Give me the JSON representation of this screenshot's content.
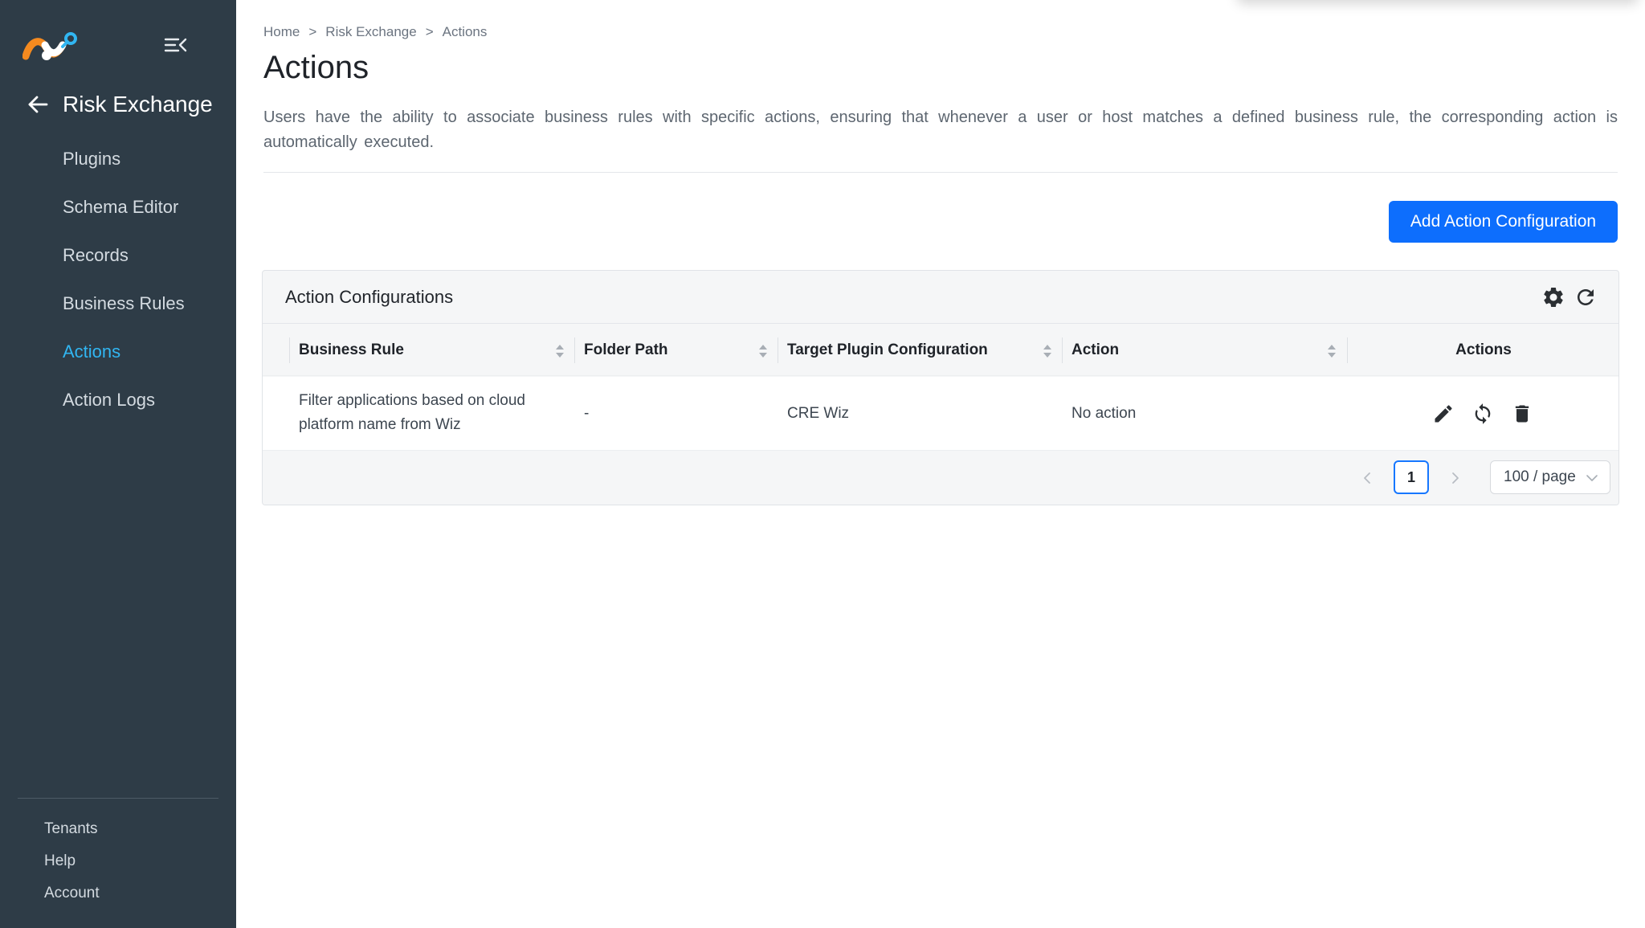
{
  "sidebar": {
    "module_title": "Risk Exchange",
    "items": [
      {
        "label": "Plugins"
      },
      {
        "label": "Schema Editor"
      },
      {
        "label": "Records"
      },
      {
        "label": "Business Rules"
      },
      {
        "label": "Actions"
      },
      {
        "label": "Action Logs"
      }
    ],
    "active_item": "Actions",
    "bottom_items": [
      {
        "label": "Tenants"
      },
      {
        "label": "Help"
      },
      {
        "label": "Account"
      }
    ],
    "colors": {
      "background": "#2e3c47",
      "active": "#31b6f2"
    }
  },
  "breadcrumb": [
    "Home",
    "Risk Exchange",
    "Actions"
  ],
  "breadcrumb_separator": ">",
  "page": {
    "title": "Actions",
    "description": "Users have the ability to associate business rules with specific actions, ensuring that whenever a user or host matches a defined business rule, the corresponding action is automatically executed.",
    "add_button_label": "Add Action Configuration",
    "accent": "#0d6efd"
  },
  "card": {
    "title": "Action Configurations",
    "icons": [
      "gear-icon",
      "refresh-icon"
    ]
  },
  "table": {
    "columns": [
      "Business Rule",
      "Folder Path",
      "Target Plugin Configuration",
      "Action",
      "Actions"
    ],
    "rows": [
      {
        "business_rule": "Filter applications based on cloud platform name from Wiz",
        "folder_path": "-",
        "target_plugin": "CRE Wiz",
        "action": "No action",
        "row_actions": [
          "edit-icon",
          "sync-icon",
          "delete-icon"
        ]
      }
    ]
  },
  "pagination": {
    "current_page": "1",
    "page_size": "100 / page"
  }
}
